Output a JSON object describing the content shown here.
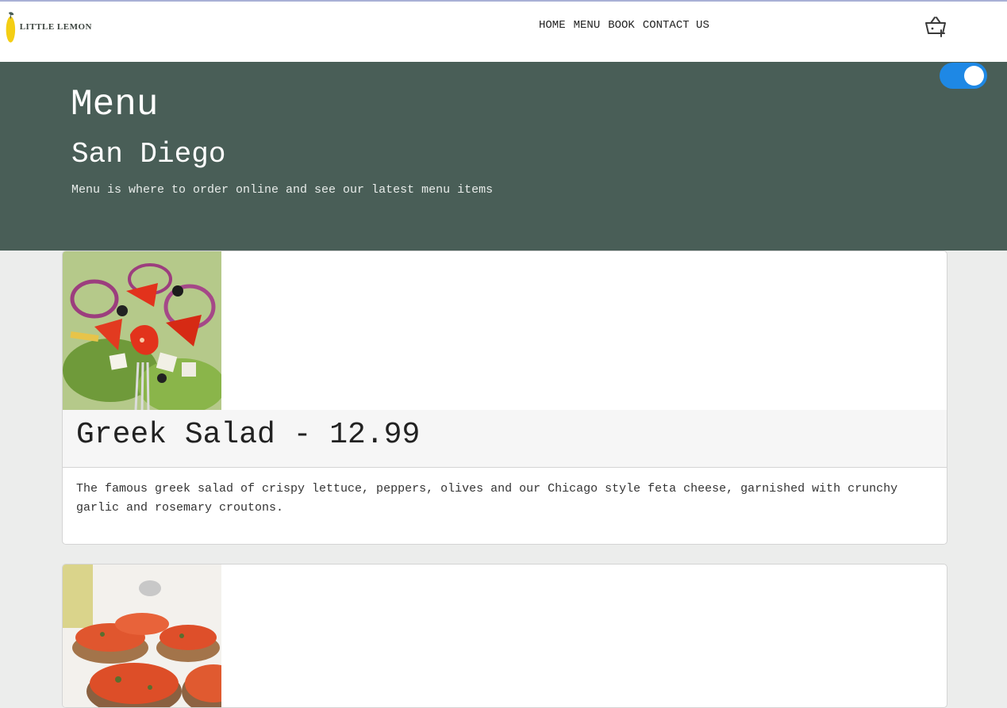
{
  "brand": {
    "logo_text": "LITTLE LEMON",
    "accent_yellow": "#f4ce14",
    "green": "#495e57"
  },
  "nav": {
    "items": [
      {
        "label": "HOME"
      },
      {
        "label": "MENU"
      },
      {
        "label": "BOOK"
      },
      {
        "label": "CONTACT US"
      }
    ],
    "cart_icon": "basket-plus-icon"
  },
  "theme_toggle": {
    "state": "on",
    "color": "#1e88e5"
  },
  "hero": {
    "title": "Menu",
    "subtitle": "San Diego",
    "description": "Menu is where to order online and see our latest menu items"
  },
  "menu_items": [
    {
      "title": "Greek Salad - 12.99",
      "description": "The famous greek salad of crispy lettuce, peppers, olives and our Chicago style feta cheese, garnished with crunchy garlic and rosemary croutons.",
      "image_icon": "greek-salad-photo"
    },
    {
      "image_icon": "bruschetta-photo"
    }
  ]
}
